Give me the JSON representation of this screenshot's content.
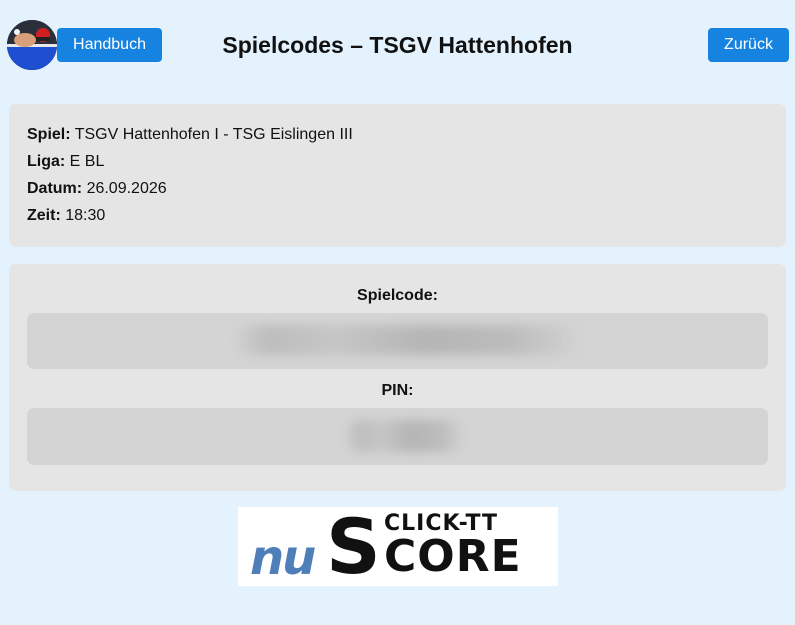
{
  "header": {
    "handbook_label": "Handbuch",
    "title": "Spielcodes – TSGV Hattenhofen",
    "back_label": "Zurück",
    "avatar_icon": "table-tennis-photo-icon"
  },
  "match": {
    "game_label": "Spiel:",
    "game_value": "TSGV Hattenhofen I - TSG Eislingen III",
    "league_label": "Liga:",
    "league_value": "E BL",
    "date_label": "Datum:",
    "date_value": "26.09.2026",
    "time_label": "Zeit:",
    "time_value": "18:30"
  },
  "codes": {
    "spielcode_label": "Spielcode:",
    "pin_label": "PIN:"
  },
  "logo": {
    "top_text": "CLICK-TT",
    "left_text": "nu",
    "big_letter": "S",
    "right_text": "CORE"
  },
  "colors": {
    "background": "#e3f2fd",
    "button": "#1683e0",
    "card": "#e5e5e5",
    "code_box": "#d4d4d4",
    "logo_blue": "#4f7fb8"
  }
}
